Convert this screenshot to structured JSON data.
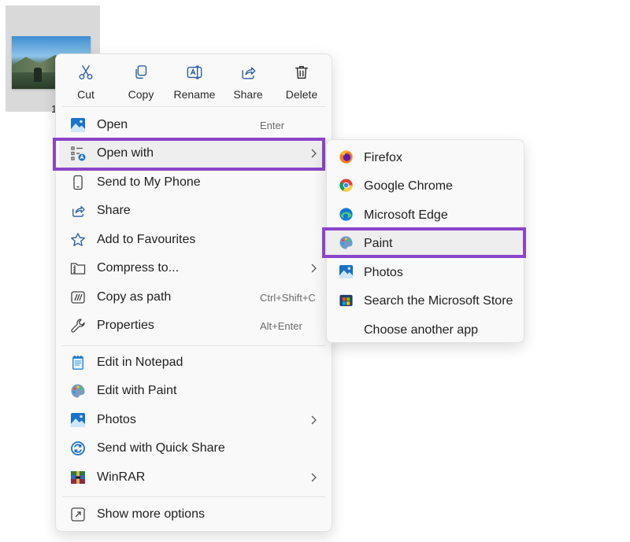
{
  "file": {
    "name": "1"
  },
  "toolbar": {
    "cut": "Cut",
    "copy": "Copy",
    "rename": "Rename",
    "share": "Share",
    "delete": "Delete"
  },
  "menu": {
    "open": {
      "label": "Open",
      "shortcut": "Enter",
      "icon": "photos-app-icon"
    },
    "open_with": {
      "label": "Open with",
      "icon": "open-with-icon"
    },
    "send_phone": {
      "label": "Send to My Phone",
      "icon": "phone-icon"
    },
    "share": {
      "label": "Share",
      "icon": "share-icon"
    },
    "favourites": {
      "label": "Add to Favourites",
      "icon": "star-icon"
    },
    "compress": {
      "label": "Compress to...",
      "icon": "zip-folder-icon"
    },
    "copy_path": {
      "label": "Copy as path",
      "shortcut": "Ctrl+Shift+C",
      "icon": "copy-path-icon"
    },
    "properties": {
      "label": "Properties",
      "shortcut": "Alt+Enter",
      "icon": "wrench-icon"
    },
    "notepad": {
      "label": "Edit in Notepad",
      "icon": "notepad-icon"
    },
    "edit_paint": {
      "label": "Edit with Paint",
      "icon": "paint-icon"
    },
    "photos": {
      "label": "Photos",
      "icon": "photos-app-icon"
    },
    "quick_share": {
      "label": "Send with Quick Share",
      "icon": "quick-share-icon"
    },
    "winrar": {
      "label": "WinRAR",
      "icon": "winrar-icon"
    },
    "more_options": {
      "label": "Show more options",
      "icon": "more-options-icon"
    }
  },
  "submenu": {
    "firefox": "Firefox",
    "chrome": "Google Chrome",
    "edge": "Microsoft Edge",
    "paint": "Paint",
    "photos": "Photos",
    "store": "Search the Microsoft Store",
    "choose": "Choose another app"
  },
  "colors": {
    "highlight_border": "#8c45c9",
    "menu_bg": "#f9f9f9",
    "accent_blue": "#1a73c9"
  }
}
